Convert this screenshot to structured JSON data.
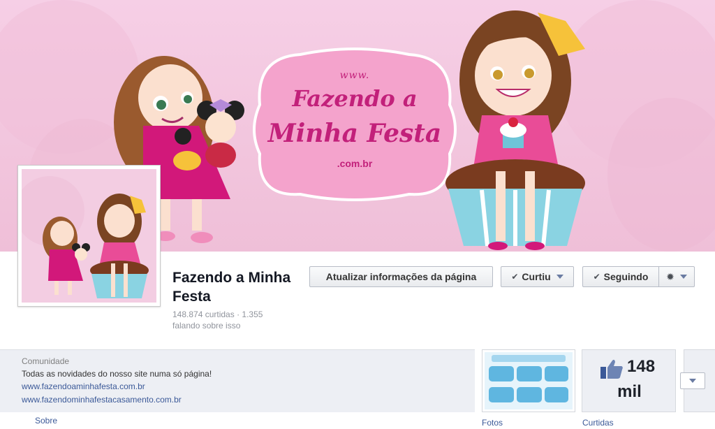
{
  "cover": {
    "logo": {
      "www": "www.",
      "line1": "Fazendo a",
      "line2": "Minha Festa",
      "domain": ".com.br"
    }
  },
  "page": {
    "name": "Fazendo a Minha Festa",
    "stats": "148.874 curtidas · 1.355 falando sobre isso"
  },
  "actions": {
    "update_label": "Atualizar informações da página",
    "liked_label": "Curtiu",
    "following_label": "Seguindo"
  },
  "about": {
    "category": "Comunidade",
    "description": "Todas as novidades do nosso site numa só página!",
    "link1": "www.fazendoaminhafesta.com.br",
    "link2": "www.fazendominhafestacasamento.com.br"
  },
  "tabs": {
    "about": "Sobre",
    "photos": "Fotos",
    "likes": "Curtidas"
  },
  "likes_box": {
    "count": "148",
    "unit": "mil"
  },
  "colors": {
    "accent_pink": "#c2207a",
    "link_blue": "#3b5998"
  },
  "icons": [
    "check-icon",
    "chevron-down-icon",
    "gear-icon",
    "thumbs-up-icon"
  ]
}
